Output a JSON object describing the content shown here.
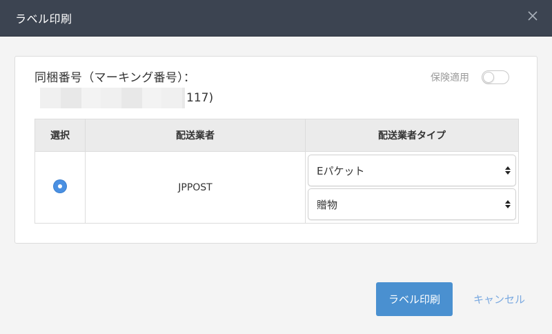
{
  "dialog": {
    "title": "ラベル印刷"
  },
  "package": {
    "label": "同梱番号（マーキング番号）：",
    "value_suffix": "117)"
  },
  "insurance": {
    "label": "保険適用",
    "enabled": false
  },
  "table": {
    "headers": [
      "選択",
      "配送業者",
      "配送業者タイプ"
    ],
    "rows": [
      {
        "selected": true,
        "carrier": "JPPOST",
        "type_selects": [
          "Eパケット",
          "贈物"
        ]
      }
    ]
  },
  "footer": {
    "print_label": "ラベル印刷",
    "cancel_label": "キャンセル"
  },
  "colors": {
    "titlebar": "#3c4451",
    "primary": "#4a90d0",
    "link": "#7aa9e0",
    "radio": "#4a90e2"
  }
}
